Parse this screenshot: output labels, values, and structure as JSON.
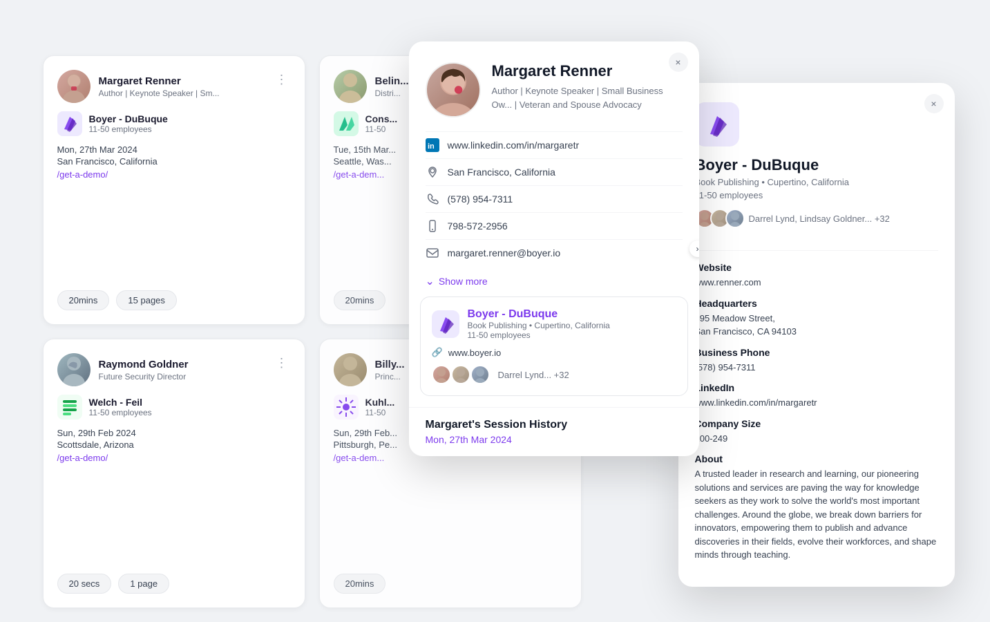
{
  "cards": [
    {
      "id": "margaret-renner",
      "name": "Margaret Renner",
      "title": "Author | Keynote Speaker | Sm...",
      "company_name": "Boyer - DuBuque",
      "employees": "11-50 employees",
      "date": "Mon, 27th Mar 2024",
      "location": "San Francisco, California",
      "link": "/get-a-demo/",
      "badge1": "20mins",
      "badge2": "15 pages",
      "logo_type": "purple_paper"
    },
    {
      "id": "belin",
      "name": "Belin...",
      "title": "Distri...",
      "company_name": "Cons...",
      "employees": "11-50",
      "date": "Tue, 15th Mar...",
      "location": "Seattle, Was...",
      "link": "/get-a-dem...",
      "badge1": "20mins",
      "badge2": "",
      "logo_type": "green_arrows"
    },
    {
      "id": "raymond-goldner",
      "name": "Raymond Goldner",
      "title": "Future Security Director",
      "company_name": "Welch - Feil",
      "employees": "11-50 employees",
      "date": "Sun, 29th Feb 2024",
      "location": "Scottsdale, Arizona",
      "link": "/get-a-demo/",
      "badge1": "20 secs",
      "badge2": "1 page",
      "logo_type": "striped"
    },
    {
      "id": "billy",
      "name": "Billy...",
      "title": "Princ...",
      "company_name": "Kuhl...",
      "employees": "11-50",
      "date": "Sun, 29th Feb...",
      "location": "Pittsburgh, Pe...",
      "link": "/get-a-dem...",
      "badge1": "20mins",
      "badge2": "",
      "logo_type": "sunburst"
    }
  ],
  "person_modal": {
    "name": "Margaret Renner",
    "title": "Author | Keynote Speaker | Small Business Ow... | Veteran and Spouse Advocacy",
    "linkedin": "www.linkedin.com/in/margaretr",
    "location": "San Francisco, California",
    "phone": "(578) 954-7311",
    "mobile": "798-572-2956",
    "email": "margaret.renner@boyer.io",
    "show_more": "Show more",
    "company_name": "Boyer - DuBuque",
    "company_industry": "Book Publishing • Cupertino, California",
    "company_employees": "11-50 employees",
    "company_website": "www.boyer.io",
    "team_label": "Darrel Lynd... +32",
    "session_title": "Margaret's Session History",
    "session_date": "Mon, 27th Mar 2024"
  },
  "company_panel": {
    "name": "Boyer - DuBuque",
    "industry": "Book Publishing • Cupertino, California",
    "employees": "11-50 employees",
    "team_label": "Darrel Lynd, Lindsay Goldner... +32",
    "website_label": "Website",
    "website_value": "www.renner.com",
    "hq_label": "Headquarters",
    "hq_value": "595 Meadow Street,\nSan Francisco, CA 94103",
    "phone_label": "Business Phone",
    "phone_value": "(578) 954-7311",
    "linkedin_label": "LinkedIn",
    "linkedin_value": "www.linkedin.com/in/margaretr",
    "size_label": "Company Size",
    "size_value": "100-249",
    "about_label": "About",
    "about_value": "A trusted leader in research and learning, our pioneering solutions and services are paving the way for knowledge seekers as they work to solve the world's most important challenges. Around the globe, we break down barriers for innovators, empowering them to publish and advance discoveries in their fields, evolve their workforces, and shape minds through teaching."
  },
  "icons": {
    "close": "×",
    "linkedin": "in",
    "location_pin": "◎",
    "phone": "☎",
    "mobile": "📱",
    "email": "✉",
    "chevron_down": "⌄",
    "link": "🔗",
    "dots": "⋮",
    "right_arrow": "›"
  }
}
